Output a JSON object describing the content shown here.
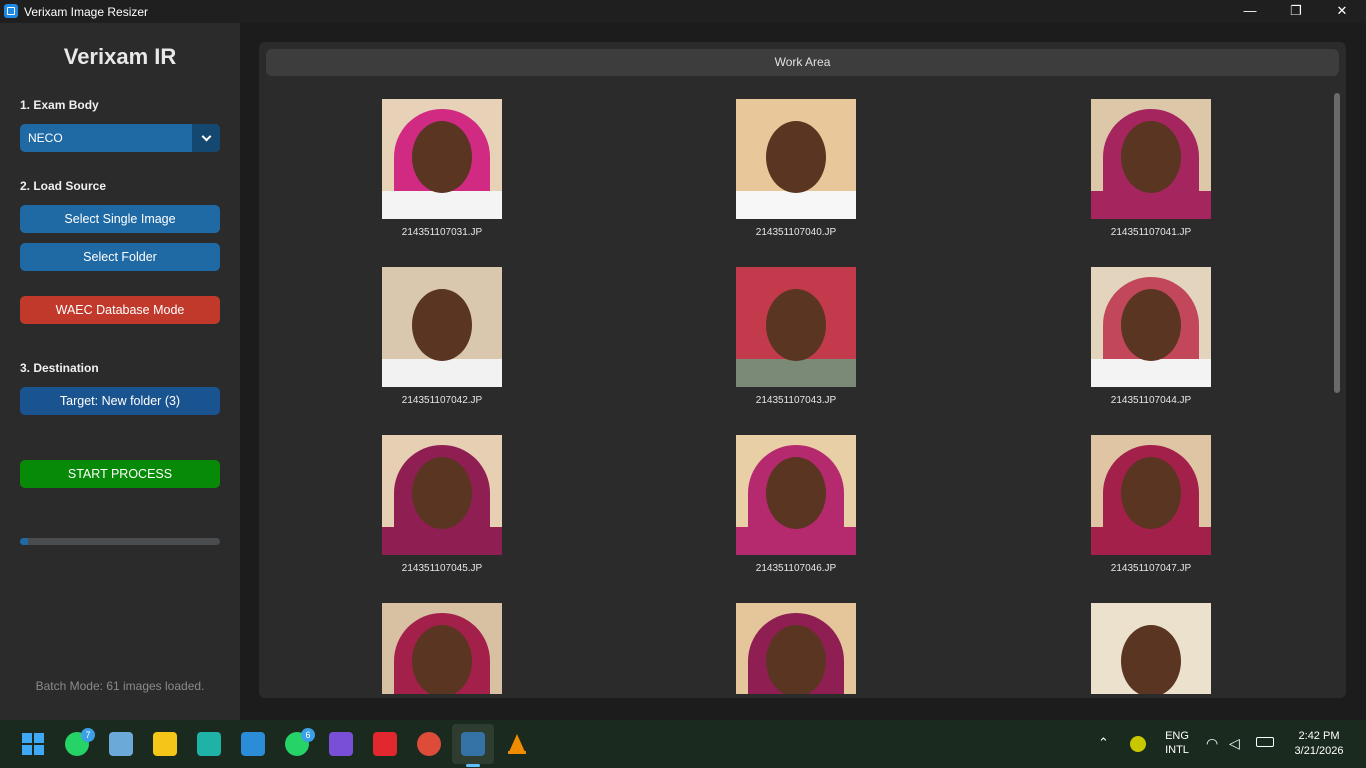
{
  "window": {
    "title": "Verixam Image Resizer",
    "controls": {
      "minimize": "—",
      "maximize": "❐",
      "close": "✕"
    }
  },
  "sidebar": {
    "brand": "Verixam IR",
    "exam_body": {
      "label": "1. Exam Body",
      "selected": "NECO"
    },
    "load_source": {
      "label": "2. Load Source",
      "single_image": "Select Single Image",
      "folder": "Select Folder"
    },
    "waec_mode": "WAEC Database Mode",
    "destination": {
      "label": "3. Destination",
      "target": "Target: New folder (3)"
    },
    "start": "START PROCESS",
    "status": "Batch Mode: 61 images loaded."
  },
  "work_area": {
    "title": "Work Area",
    "images": [
      {
        "filename": "214351107031.JP",
        "bg": "#e7d2b8",
        "scarf": "#d02a83",
        "shirt": "#f4f4f4"
      },
      {
        "filename": "214351107040.JP",
        "bg": "#e8c89a",
        "scarf": "",
        "shirt": "#f7f7f7"
      },
      {
        "filename": "214351107041.JP",
        "bg": "#dcc8a8",
        "scarf": "#a5265f",
        "shirt": "#a5265f"
      },
      {
        "filename": "214351107042.JP",
        "bg": "#d9c7ae",
        "scarf": "",
        "shirt": "#f2f2f2"
      },
      {
        "filename": "214351107043.JP",
        "bg": "#c23a4c",
        "scarf": "",
        "shirt": "#7a8a76"
      },
      {
        "filename": "214351107044.JP",
        "bg": "#e2d4bd",
        "scarf": "#c2475a",
        "shirt": "#f3f3f3"
      },
      {
        "filename": "214351107045.JP",
        "bg": "#e6cfb2",
        "scarf": "#8f1f52",
        "shirt": "#8f1f52"
      },
      {
        "filename": "214351107046.JP",
        "bg": "#e9cfa6",
        "scarf": "#b52a6f",
        "shirt": "#b52a6f"
      },
      {
        "filename": "214351107047.JP",
        "bg": "#dfc5a3",
        "scarf": "#a3204a",
        "shirt": "#a3204a"
      },
      {
        "filename": "",
        "bg": "#d8c0a2",
        "scarf": "#a3204a",
        "shirt": "#a3204a"
      },
      {
        "filename": "",
        "bg": "#e5c59a",
        "scarf": "#8f1f52",
        "shirt": "#8f1f52"
      },
      {
        "filename": "",
        "bg": "#ece1cc",
        "scarf": "",
        "shirt": "#eaeaea"
      }
    ]
  },
  "taskbar": {
    "whatsapp_badge": "7",
    "whatsapp2_badge": "6",
    "lang_top": "ENG",
    "lang_bottom": "INTL",
    "time": "2:42 PM",
    "date": "3/21/2026",
    "icon_colors": [
      "#3fa9f5",
      "#25d366",
      "#6aa9d8",
      "#f5c518",
      "#1fb2a6",
      "#2b8cd8",
      "#25d366",
      "#7a4fd8",
      "#e0282e",
      "#dd4b39",
      "#3572a5",
      "#f08c00"
    ]
  }
}
